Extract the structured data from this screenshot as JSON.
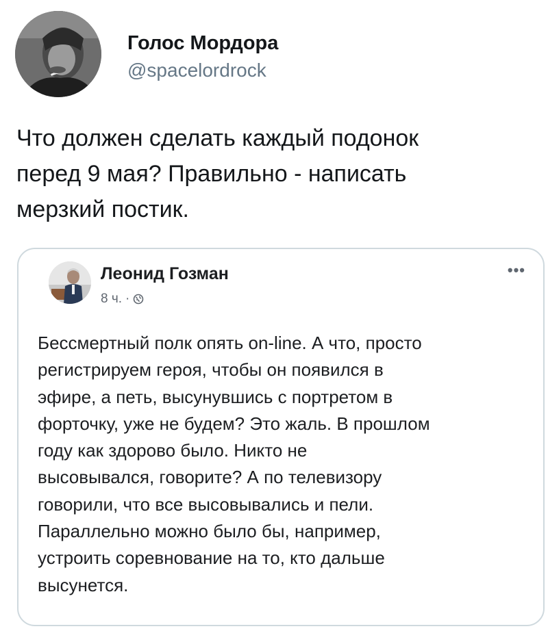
{
  "tweet": {
    "display_name": "Голос Мордора",
    "handle": "@spacelordrock",
    "text": "Что должен сделать каждый подонок\nперед 9 мая? Правильно - написать\nмерзкий постик."
  },
  "quoted_post": {
    "author_name": "Леонид Гозман",
    "time": "8 ч.",
    "separator": "·",
    "more": "•••",
    "text": "Бессмертный полк опять on-line. А что, просто\nрегистрируем героя, чтобы он появился в\nэфире, а петь, высунувшись с портретом в\nфорточку, уже не будем? Это жаль. В прошлом\nгоду как здорово было. Никто не\nвысовывался, говорите? А по телевизору\nговорили, что все высовывались и пели.\nПараллельно можно было бы, например,\nустроить соревнование на то, кто дальше\nвысунется."
  },
  "icons": {
    "avatar": "avatar-photo",
    "quoted_avatar": "avatar-photo",
    "audience": "globe-icon",
    "more": "more-options-icon"
  },
  "colors": {
    "text": "#14171a",
    "secondary": "#657786",
    "card_border": "#cfd9de"
  }
}
